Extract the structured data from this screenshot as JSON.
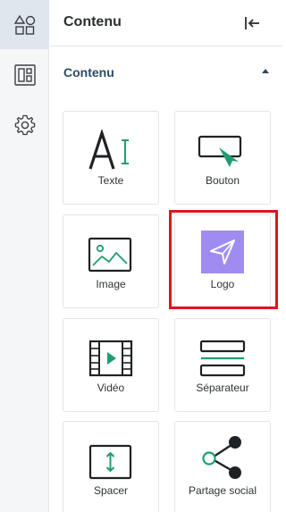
{
  "panel": {
    "title": "Contenu",
    "section_title": "Contenu"
  },
  "rail": {
    "items": [
      {
        "icon": "shapes-icon",
        "active": true
      },
      {
        "icon": "layout-icon",
        "active": false
      },
      {
        "icon": "gear-icon",
        "active": false
      }
    ]
  },
  "tiles": [
    {
      "label": "Texte",
      "icon": "text-icon"
    },
    {
      "label": "Bouton",
      "icon": "button-icon"
    },
    {
      "label": "Image",
      "icon": "image-icon"
    },
    {
      "label": "Logo",
      "icon": "logo-icon",
      "selected": true
    },
    {
      "label": "Vidéo",
      "icon": "video-icon"
    },
    {
      "label": "Séparateur",
      "icon": "separator-icon"
    },
    {
      "label": "Spacer",
      "icon": "spacer-icon"
    },
    {
      "label": "Partage social",
      "icon": "social-share-icon"
    }
  ],
  "colors": {
    "accent_green": "#1e9e6e",
    "logo_purple": "#a08cf0",
    "selection_red": "#e0141e",
    "section_title": "#2a4a66"
  }
}
